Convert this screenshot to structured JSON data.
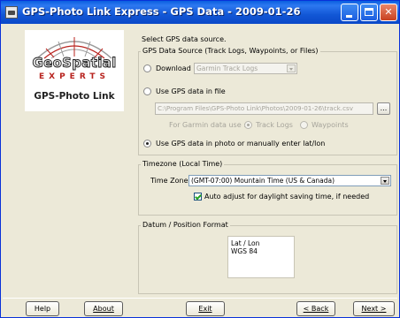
{
  "window": {
    "title": "GPS-Photo Link Express - GPS Data - 2009-01-26",
    "title_color": "#0a5ee0"
  },
  "logo": {
    "brand_line1": "GeoSpatial",
    "brand_line2": "EXPERTS",
    "product": "GPS-Photo Link",
    "accent_color": "#b8231e"
  },
  "source": {
    "prompt": "Select GPS data source.",
    "group_label": "GPS Data Source (Track Logs, Waypoints, or Files)",
    "download_label": "Download",
    "download_combo_value": "Garmin Track Logs",
    "file_label": "Use GPS data in file",
    "file_path": "C:\\Program Files\\GPS-Photo Link\\Photos\\2009-01-26\\track.csv",
    "browse_label": "...",
    "garmin_use_label": "For Garmin data use :",
    "track_logs_label": "Track Logs",
    "waypoints_label": "Waypoints",
    "photo_label": "Use GPS data in photo or manually enter lat/lon",
    "selected": "photo"
  },
  "timezone": {
    "group_label": "Timezone (Local Time)",
    "zone_label": "Time Zone",
    "zone_value": "(GMT-07:00) Mountain Time (US & Canada)",
    "auto_adjust_label": "Auto adjust for daylight saving time, if needed",
    "auto_adjust_checked": true
  },
  "datum": {
    "group_label": "Datum / Position Format",
    "line1": "Lat / Lon",
    "line2": "WGS 84"
  },
  "buttons": {
    "help": "Help",
    "about": "About",
    "exit": "Exit",
    "back": "< Back",
    "next": "Next >"
  }
}
